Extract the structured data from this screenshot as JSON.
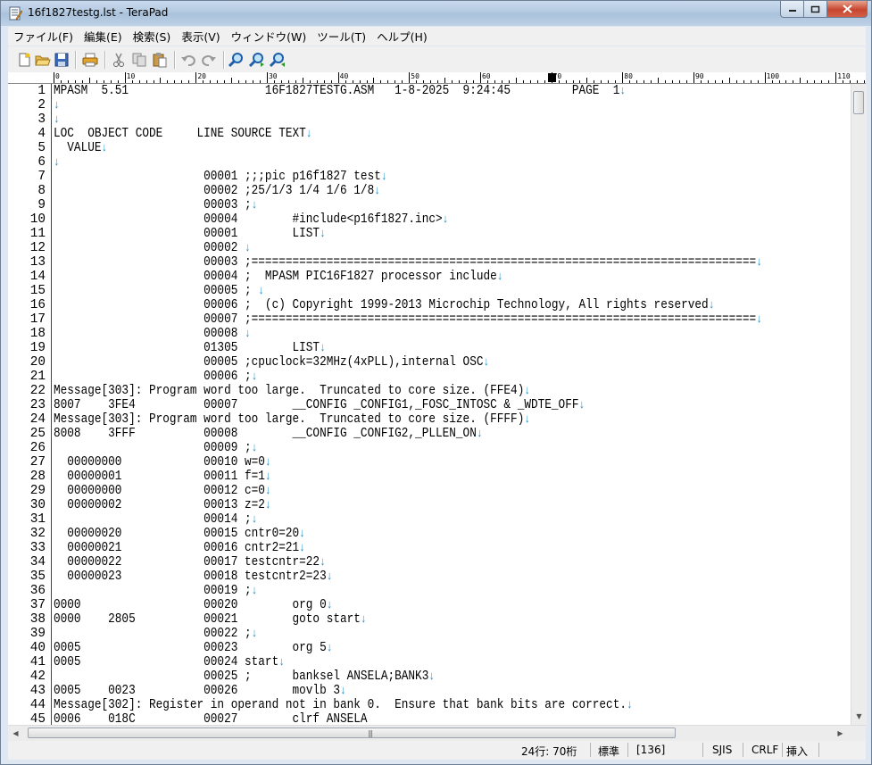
{
  "window": {
    "title": "16f1827testg.lst - TeraPad"
  },
  "menu": [
    "ファイル(F)",
    "編集(E)",
    "検索(S)",
    "表示(V)",
    "ウィンドウ(W)",
    "ツール(T)",
    "ヘルプ(H)"
  ],
  "toolbar": [
    "new-file-icon",
    "open-folder-icon",
    "save-icon",
    "print-icon",
    "cut-icon",
    "copy-icon",
    "paste-icon",
    "undo-icon",
    "redo-icon",
    "find-icon",
    "find-next-icon",
    "find-prev-icon"
  ],
  "ruler": {
    "labels": [
      "0",
      "10",
      "20",
      "30",
      "40",
      "50",
      "60",
      "70",
      "80",
      "90",
      "100",
      "110"
    ]
  },
  "lines": [
    {
      "n": "1",
      "t": "MPASM  5.51                    16F1827TESTG.ASM   1-8-2025  9:24:45         PAGE  1"
    },
    {
      "n": "2",
      "t": ""
    },
    {
      "n": "3",
      "t": ""
    },
    {
      "n": "4",
      "t": "LOC  OBJECT CODE     LINE SOURCE TEXT"
    },
    {
      "n": "5",
      "t": "  VALUE"
    },
    {
      "n": "6",
      "t": ""
    },
    {
      "n": "7",
      "t": "                      00001 ;;;pic p16f1827 test"
    },
    {
      "n": "8",
      "t": "                      00002 ;25/1/3 1/4 1/6 1/8"
    },
    {
      "n": "9",
      "t": "                      00003 ;"
    },
    {
      "n": "10",
      "t": "                      00004        #include<p16f1827.inc>"
    },
    {
      "n": "11",
      "t": "                      00001        LIST"
    },
    {
      "n": "12",
      "t": "                      00002 "
    },
    {
      "n": "13",
      "t": "                      00003 ;=========================================================================="
    },
    {
      "n": "14",
      "t": "                      00004 ;  MPASM PIC16F1827 processor include"
    },
    {
      "n": "15",
      "t": "                      00005 ; "
    },
    {
      "n": "16",
      "t": "                      00006 ;  (c) Copyright 1999-2013 Microchip Technology, All rights reserved"
    },
    {
      "n": "17",
      "t": "                      00007 ;=========================================================================="
    },
    {
      "n": "18",
      "t": "                      00008 "
    },
    {
      "n": "19",
      "t": "                      01305        LIST"
    },
    {
      "n": "20",
      "t": "                      00005 ;cpuclock=32MHz(4xPLL),internal OSC"
    },
    {
      "n": "21",
      "t": "                      00006 ;"
    },
    {
      "n": "22",
      "t": "Message[303]: Program word too large.  Truncated to core size. (FFE4)"
    },
    {
      "n": "23",
      "t": "8007    3FE4          00007        __CONFIG _CONFIG1,_FOSC_INTOSC & _WDTE_OFF"
    },
    {
      "n": "24",
      "t": "Message[303]: Program word too large.  Truncated to core size. (FFFF)"
    },
    {
      "n": "25",
      "t": "8008    3FFF          00008        __CONFIG _CONFIG2,_PLLEN_ON"
    },
    {
      "n": "26",
      "t": "                      00009 ;"
    },
    {
      "n": "27",
      "t": "  00000000            00010 w=0"
    },
    {
      "n": "28",
      "t": "  00000001            00011 f=1"
    },
    {
      "n": "29",
      "t": "  00000000            00012 c=0"
    },
    {
      "n": "30",
      "t": "  00000002            00013 z=2"
    },
    {
      "n": "31",
      "t": "                      00014 ;"
    },
    {
      "n": "32",
      "t": "  00000020            00015 cntr0=20"
    },
    {
      "n": "33",
      "t": "  00000021            00016 cntr2=21"
    },
    {
      "n": "34",
      "t": "  00000022            00017 testcntr=22"
    },
    {
      "n": "35",
      "t": "  00000023            00018 testcntr2=23"
    },
    {
      "n": "36",
      "t": "                      00019 ;"
    },
    {
      "n": "37",
      "t": "0000                  00020        org 0"
    },
    {
      "n": "38",
      "t": "0000    2805          00021        goto start"
    },
    {
      "n": "39",
      "t": "                      00022 ;"
    },
    {
      "n": "40",
      "t": "0005                  00023        org 5"
    },
    {
      "n": "41",
      "t": "0005                  00024 start"
    },
    {
      "n": "42",
      "t": "                      00025 ;      banksel ANSELA;BANK3"
    },
    {
      "n": "43",
      "t": "0005    0023          00026        movlb 3"
    },
    {
      "n": "44",
      "t": "Message[302]: Register in operand not in bank 0.  Ensure that bank bits are correct."
    },
    {
      "n": "45",
      "t": "0006    018C          00027        clrf ANSELA"
    }
  ],
  "eol_mark": "↓",
  "status": {
    "position": "24行:  70桁",
    "mode": "標準",
    "code": "[136]",
    "encoding": "SJIS",
    "newline": "CRLF",
    "insert": "挿入"
  },
  "colors": {
    "eol": "#1a8ecb",
    "titlebar": "#b3c9e0"
  }
}
